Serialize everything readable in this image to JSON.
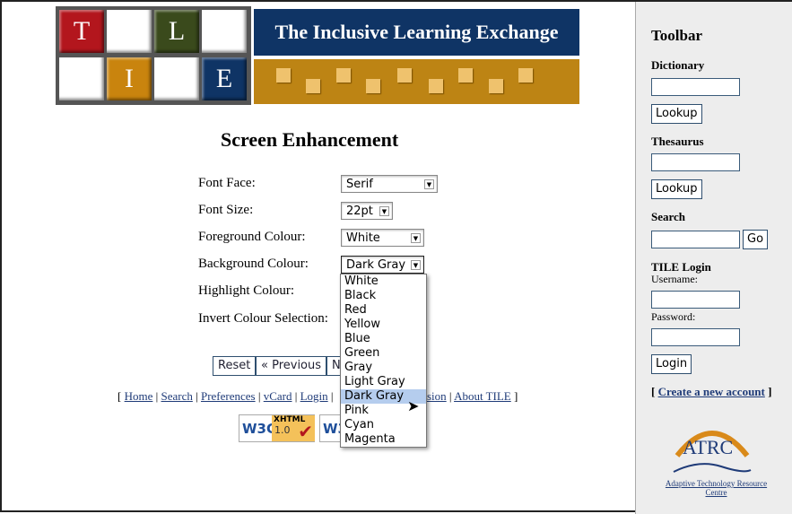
{
  "logo": {
    "letters": [
      "T",
      "L",
      "I",
      "E"
    ],
    "banner": "The Inclusive Learning Exchange"
  },
  "page_title": "Screen Enhancement",
  "form": {
    "font_face": {
      "label": "Font Face:",
      "value": "Serif"
    },
    "font_size": {
      "label": "Font Size:",
      "value": "22pt"
    },
    "foreground": {
      "label": "Foreground Colour:",
      "value": "White"
    },
    "background": {
      "label": "Background Colour:",
      "value": "Dark Gray",
      "options": [
        "White",
        "Black",
        "Red",
        "Yellow",
        "Blue",
        "Green",
        "Gray",
        "Light Gray",
        "Dark Gray",
        "Pink",
        "Cyan",
        "Magenta"
      ],
      "highlighted": "Dark Gray"
    },
    "highlight": {
      "label": "Highlight Colour:"
    },
    "invert": {
      "label": "Invert Colour Selection:"
    }
  },
  "buttons": {
    "reset": "Reset",
    "previous": "« Previous",
    "next_partial": "N"
  },
  "nav": {
    "links": [
      "Home",
      "Search",
      "Preferences",
      "vCard",
      "Login"
    ],
    "partial": "sion",
    "about": "About TILE"
  },
  "badges": {
    "w3c": "W3C",
    "xhtml": "XHTML",
    "version": "1.0"
  },
  "toolbar": {
    "title": "Toolbar",
    "dictionary": "Dictionary",
    "lookup": "Lookup",
    "thesaurus": "Thesaurus",
    "search": "Search",
    "go": "Go",
    "login_title": "TILE Login",
    "username": "Username:",
    "password": "Password:",
    "login": "Login",
    "create": "Create a new account",
    "atrc": "ATRC",
    "atrc_name": "Adaptive Technology Resource Centre"
  },
  "colors": {
    "navy": "#0f3465",
    "gold": "#bd8414",
    "red": "#b3161d",
    "green": "#3a4a1c",
    "highlight": "#b5cdee"
  }
}
